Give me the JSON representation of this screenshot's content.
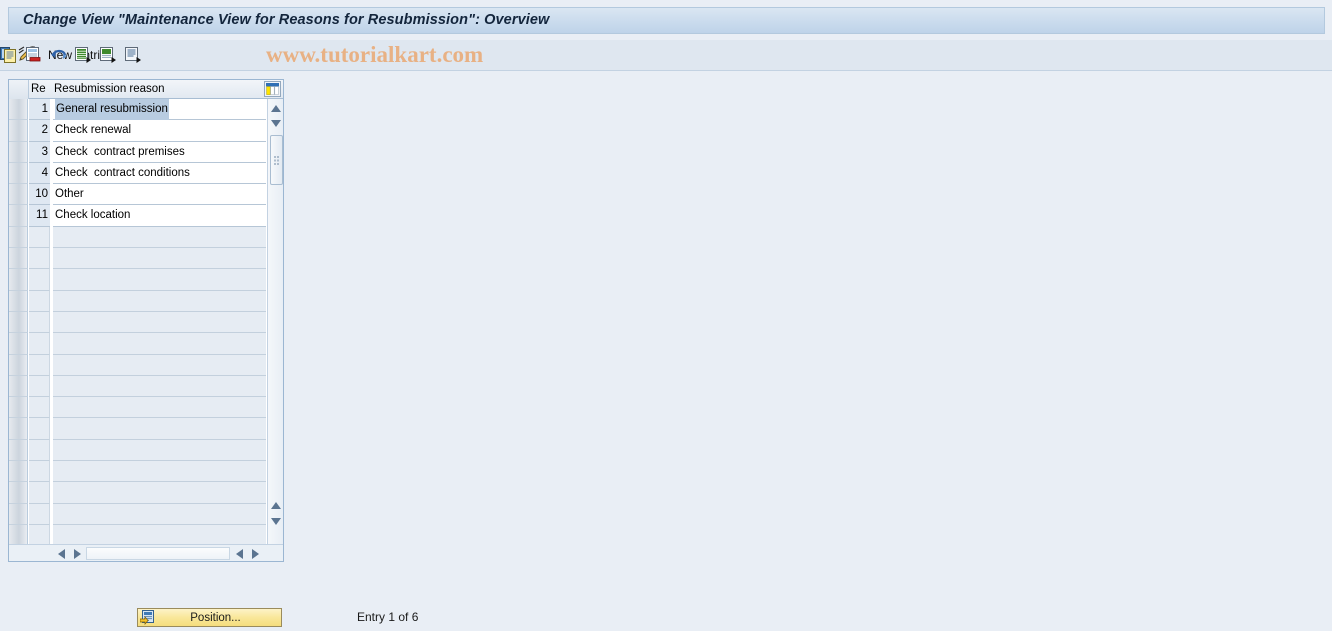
{
  "window": {
    "title": "Change View \"Maintenance View for Reasons for Resubmission\": Overview"
  },
  "toolbar": {
    "pencil_icon": "pencil-change-icon",
    "new_entries_label": "New Entries",
    "buttons": [
      {
        "name": "copy-as-icon",
        "title": "Copy As..."
      },
      {
        "name": "delete-icon",
        "title": "Delete"
      },
      {
        "name": "undo-icon",
        "title": "Undo Change"
      },
      {
        "name": "select-all-icon",
        "title": "Select All"
      },
      {
        "name": "deselect-all-icon",
        "title": "Deselect All"
      },
      {
        "name": "details-icon",
        "title": "Details"
      }
    ],
    "watermark": "www.tutorialkart.com"
  },
  "table": {
    "columns": [
      "Re",
      "Resubmission reason"
    ],
    "column_config_icon": "column-configuration-icon",
    "rows": [
      {
        "key": "1",
        "reason": "General resubmission",
        "selected": true
      },
      {
        "key": "2",
        "reason": "Check renewal",
        "selected": false
      },
      {
        "key": "3",
        "reason": "Check  contract premises",
        "selected": false
      },
      {
        "key": "4",
        "reason": "Check  contract conditions",
        "selected": false
      },
      {
        "key": "10",
        "reason": "Other",
        "selected": false
      },
      {
        "key": "11",
        "reason": "Check location",
        "selected": false
      }
    ],
    "empty_row_count": 15
  },
  "scrollbars": {
    "vertical": {
      "up_icon": "scroll-up-icon",
      "down_icon": "scroll-down-icon",
      "thumb": "vertical-scroll-thumb"
    },
    "horizontal": {
      "left_icon": "scroll-left-icon",
      "right_icon": "scroll-right-icon"
    }
  },
  "footer": {
    "position_button_label": "Position...",
    "position_button_icon": "position-icon",
    "entry_status": "Entry 1 of 6"
  },
  "colors": {
    "page_background": "#e9eef5",
    "title_bar": "#c8daec",
    "toolbar": "#dfe7f0",
    "watermark": "#e8b184",
    "selection_highlight": "#b8cce1",
    "key_column": "#dfe8f2",
    "button_yellow": "#f7e391"
  }
}
